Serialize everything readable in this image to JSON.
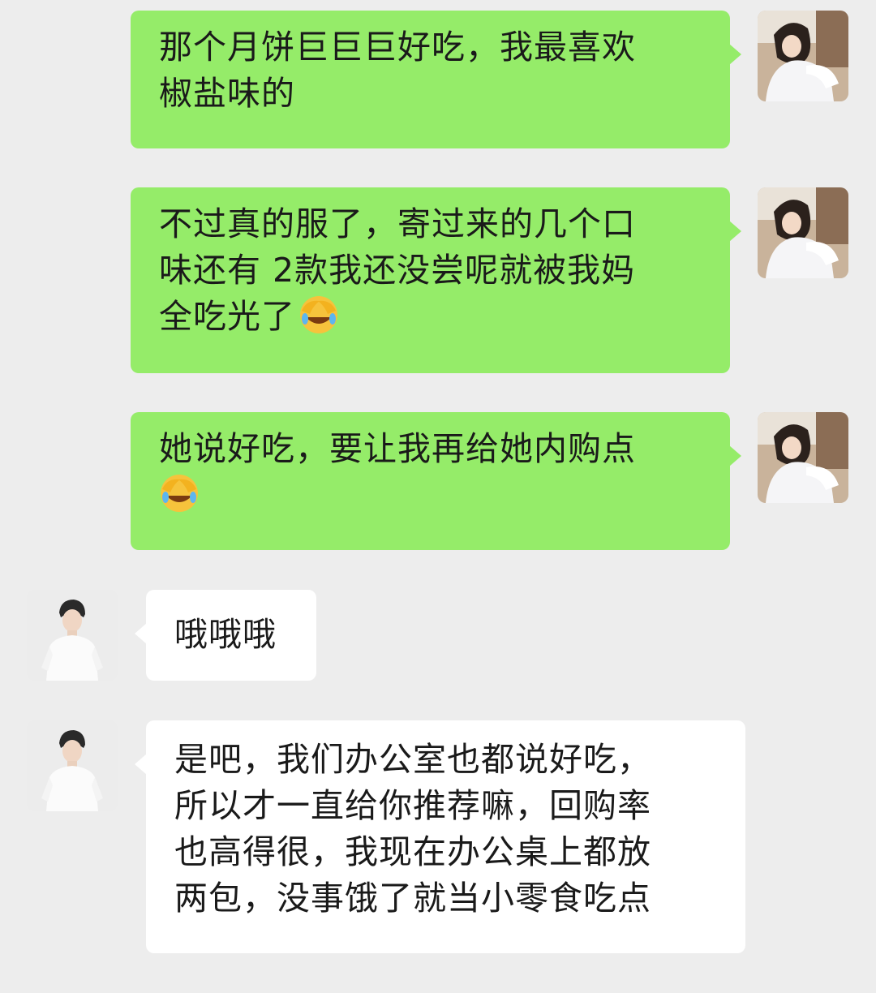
{
  "messages": [
    {
      "sender": "self",
      "lines": [
        "那个月饼巨巨巨好吃，我最喜欢",
        "椒盐味的"
      ]
    },
    {
      "sender": "self",
      "lines": [
        "不过真的服了，寄过来的几个口",
        "味还有 2款我还没尝呢就被我妈",
        "全吃光了"
      ],
      "trailing_emoji": "facepalm-laugh-emoji"
    },
    {
      "sender": "self",
      "lines": [
        "她说好吃，要让我再给她内购点"
      ],
      "trailing_emoji": "facepalm-laugh-emoji"
    },
    {
      "sender": "other",
      "lines": [
        "哦哦哦"
      ]
    },
    {
      "sender": "other",
      "lines": [
        "是吧，我们办公室也都说好吃，",
        "所以才一直给你推荐嘛，回购率",
        "也高得很，我现在办公桌上都放",
        "两包，没事饿了就当小零食吃点"
      ]
    }
  ],
  "colors": {
    "background": "#ededed",
    "sent_bubble": "#95ec69",
    "received_bubble": "#ffffff",
    "text": "#1a1a1a"
  }
}
